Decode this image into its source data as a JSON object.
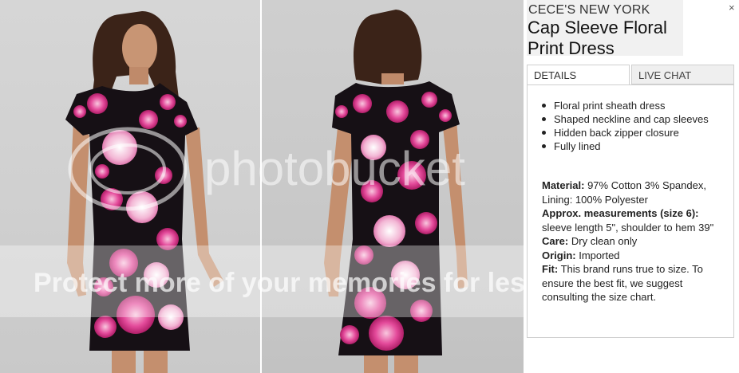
{
  "watermark": {
    "logo_text": "photobucket",
    "banner_text": "Protect more of your memories for less!"
  },
  "product": {
    "brand": "CECE'S NEW YORK",
    "title": "Cap Sleeve Floral Print Dress"
  },
  "tabs": [
    {
      "label": "DETAILS",
      "active": true
    },
    {
      "label": "LIVE CHAT",
      "active": false
    }
  ],
  "details": {
    "features": [
      "Floral print sheath dress",
      "Shaped neckline and cap sleeves",
      "Hidden back zipper closure",
      "Fully lined"
    ],
    "specs": [
      {
        "label": "Material:",
        "value": " 97% Cotton 3% Spandex, Lining: 100% Polyester"
      },
      {
        "label": "Approx. measurements (size 6):",
        "value": " sleeve length 5\", shoulder to hem 39\""
      },
      {
        "label": "Care:",
        "value": " Dry clean only"
      },
      {
        "label": "Origin:",
        "value": " Imported"
      },
      {
        "label": "Fit:",
        "value": " This brand runs true to size. To ensure the best fit, we suggest consulting the size chart."
      }
    ]
  },
  "colors": {
    "dress_base": "#161015",
    "flower_pink": "#e0368f",
    "flower_light": "#f6b6d6",
    "skin": "#c89574",
    "hair": "#3b2318"
  },
  "icons": [
    "close-icon"
  ]
}
